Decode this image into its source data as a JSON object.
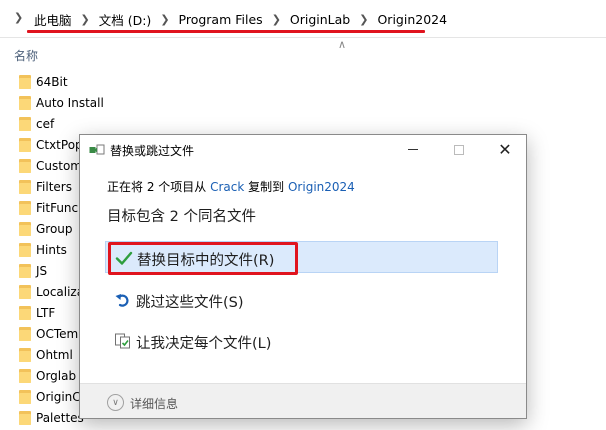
{
  "explorer": {
    "breadcrumb": [
      "此电脑",
      "文档 (D:)",
      "Program Files",
      "OriginLab",
      "Origin2024"
    ],
    "column_header": "名称",
    "files": [
      "64Bit",
      "Auto Install",
      "cef",
      "CtxtPop",
      "Custom",
      "Filters",
      "FitFunc",
      "Group",
      "Hints",
      "JS",
      "Localiza",
      "LTF",
      "OCTem",
      "Ohtml",
      "Orglab",
      "OriginC",
      "Palettes"
    ]
  },
  "dialog": {
    "title": "替换或跳过文件",
    "progress_prefix": "正在将 2 个项目从",
    "source_folder": "Crack",
    "progress_middle": "复制到",
    "dest_folder": "Origin2024",
    "summary": "目标包含 2 个同名文件",
    "options": {
      "replace": "替换目标中的文件(R)",
      "skip": "跳过这些文件(S)",
      "decide": "让我决定每个文件(L)"
    },
    "details": "详细信息"
  },
  "colors": {
    "accent": "#1a5fb4",
    "highlight_red": "#e0141e",
    "selection": "#dbeafc",
    "folder": "#f2c25a",
    "check_green": "#2e9e3e"
  }
}
